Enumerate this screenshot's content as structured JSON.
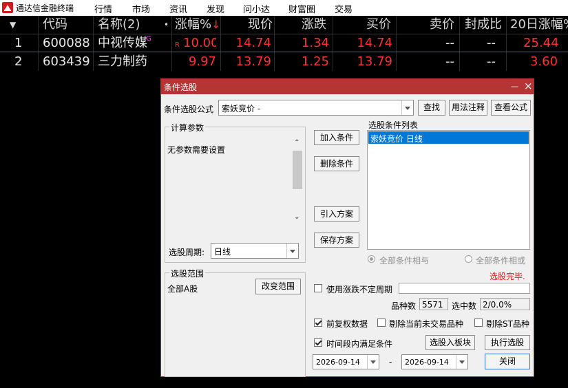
{
  "menubar": {
    "app_title": "通达信金融终端",
    "items": [
      "行情",
      "市场",
      "资讯",
      "发现",
      "问小达",
      "财富圈",
      "交易"
    ]
  },
  "table": {
    "headers": {
      "idx": "▼",
      "code": "代码",
      "name": "名称(2)",
      "name_mark": "•",
      "pct": "涨幅%",
      "pct_sort": "↓",
      "price": "现价",
      "change": "涨跌",
      "bid": "买价",
      "ask": "卖价",
      "seal": "封成比",
      "pct20": "20日涨幅%"
    },
    "rows": [
      {
        "idx": "1",
        "code": "600088",
        "name": "中视传媒",
        "name_badge": "G",
        "flag": "R",
        "pct": "10.00",
        "price": "14.74",
        "change": "1.34",
        "bid": "14.74",
        "ask": "--",
        "seal": "--",
        "pct20": "25.44"
      },
      {
        "idx": "2",
        "code": "603439",
        "name": "三力制药",
        "name_badge": "",
        "flag": "",
        "pct": "9.97",
        "price": "13.79",
        "change": "1.25",
        "bid": "13.79",
        "ask": "--",
        "seal": "--",
        "pct20": "3.60"
      }
    ]
  },
  "dialog": {
    "title": "条件选股",
    "min_glyph": "—",
    "close_glyph": "×",
    "formula_label": "条件选股公式",
    "formula_value": "索妖竞价  -",
    "find_button": "查找",
    "usage_button": "用法注释",
    "view_formula_button": "查看公式",
    "params_group": "计算参数",
    "params_text": "无参数需要设置",
    "period_label": "选股周期:",
    "period_value": "日线",
    "add_condition_button": "加入条件",
    "delete_condition_button": "删除条件",
    "import_plan_button": "引入方案",
    "save_plan_button": "保存方案",
    "conditions_label": "选股条件列表",
    "conditions": [
      "索妖竞价  日线"
    ],
    "radio_and": "全部条件相与",
    "radio_or": "全部条件相或",
    "radio_and_on": true,
    "status_text": "选股完毕.",
    "scope_group": "选股范围",
    "scope_value": "全部A股",
    "change_scope_button": "改变范围",
    "use_uncertain_period_label": "使用涨跌不定周期",
    "use_uncertain_period_checked": false,
    "count_label": "品种数",
    "count_value": "5571",
    "hit_label": "选中数",
    "hit_value": "2/0.0%",
    "pre_adjust_label": "前复权数据",
    "pre_adjust_checked": true,
    "exclude_untraded_label": "剔除当前未交易品种",
    "exclude_untraded_checked": false,
    "exclude_st_label": "剔除ST品种",
    "exclude_st_checked": false,
    "time_range_label": "时间段内满足条件",
    "time_range_checked": true,
    "to_board_button": "选股入板块",
    "execute_button": "执行选股",
    "date_from": "2026-09-14",
    "date_sep": "-",
    "date_to": "2026-09-14",
    "close_button": "关闭"
  },
  "colors": {
    "dialog_title": "#b53535",
    "up_red": "#ff3232",
    "selected_blue": "#0078d7",
    "status_red": "#e02020"
  }
}
